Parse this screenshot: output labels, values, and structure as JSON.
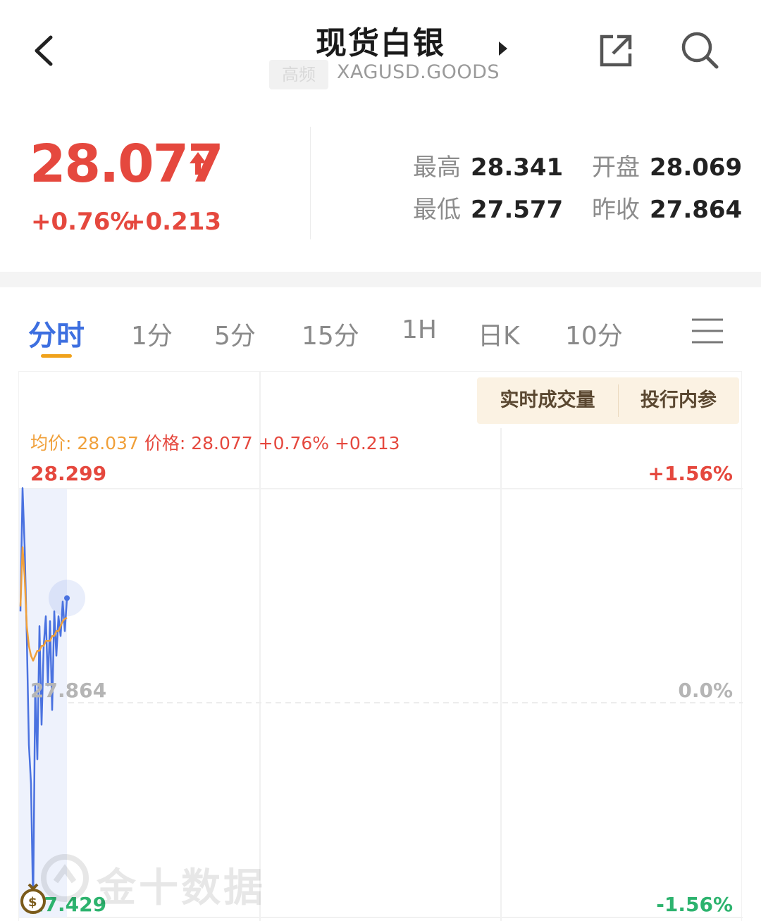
{
  "header": {
    "title": "现货白银",
    "badge": "高频",
    "symbol": "XAGUSD.GOODS"
  },
  "quote": {
    "price": "28.077",
    "change_pct": "+0.76%",
    "change_abs": "+0.213",
    "stats": [
      {
        "label": "最高",
        "value": "28.341"
      },
      {
        "label": "开盘",
        "value": "28.069"
      },
      {
        "label": "最低",
        "value": "27.577"
      },
      {
        "label": "昨收",
        "value": "27.864"
      }
    ],
    "colors": {
      "up": "#e5483e",
      "down": "#2db36e",
      "accent": "#3d6fe0"
    }
  },
  "tabs": [
    {
      "label": "分时",
      "active": true
    },
    {
      "label": "1分"
    },
    {
      "label": "5分"
    },
    {
      "label": "15分"
    },
    {
      "label": "1H"
    },
    {
      "label": "日K"
    },
    {
      "label": "10分"
    }
  ],
  "chart_panel": {
    "chips": [
      "实时成交量",
      "投行内参"
    ],
    "legend": {
      "avg_label": "均价:",
      "avg_value": "28.037",
      "price_label": "价格:",
      "price_value": "28.077",
      "pct": "+0.76%",
      "abs": "+0.213"
    },
    "axis": {
      "left_top": "28.299",
      "left_mid": "27.864",
      "left_bottom": "27.429",
      "right_top": "+1.56%",
      "right_mid": "0.0%",
      "right_bottom": "-1.56%"
    },
    "watermark": "金十数据"
  },
  "chart_data": {
    "type": "line",
    "ylim": [
      27.429,
      28.299
    ],
    "reference": 27.864,
    "series": [
      {
        "values": [
          28.05,
          28.3,
          28.18,
          28.0,
          27.78,
          27.7,
          27.45,
          27.9,
          27.75,
          28.02,
          27.82,
          27.98,
          28.04,
          27.9,
          28.03,
          27.85,
          28.05,
          27.96,
          28.04,
          28.0,
          28.07,
          28.01,
          28.077
        ]
      },
      {
        "values": [
          28.06,
          28.18,
          28.12,
          28.02,
          27.98,
          27.96,
          27.95,
          27.96,
          27.97,
          27.97,
          27.98,
          27.98,
          27.99,
          27.99,
          27.99,
          28.0,
          28.0,
          28.01,
          28.01,
          28.02,
          28.03,
          28.035,
          28.037
        ]
      }
    ]
  }
}
